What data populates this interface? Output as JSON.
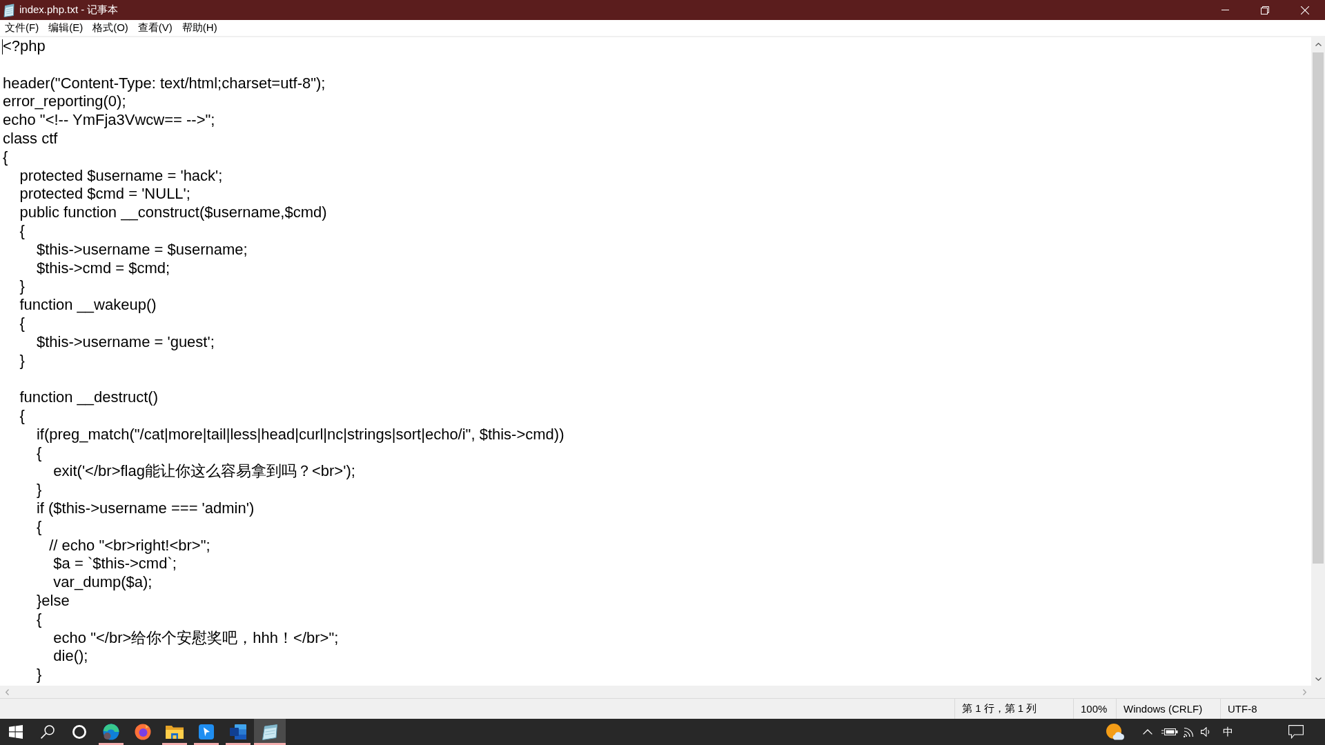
{
  "window": {
    "title": "index.php.txt - 记事本"
  },
  "menu": [
    "文件(F)",
    "编辑(E)",
    "格式(O)",
    "查看(V)",
    "帮助(H)"
  ],
  "editor": {
    "blocks": [
      [
        "<?php"
      ],
      [
        "header(\"Content-Type: text/html;charset=utf-8\");",
        "error_reporting(0);",
        "echo \"<!-- YmFja3Vwcw== -->\";",
        "class ctf",
        "{",
        "    protected $username = 'hack';",
        "    protected $cmd = 'NULL';",
        "    public function __construct($username,$cmd)",
        "    {",
        "        $this->username = $username;",
        "        $this->cmd = $cmd;",
        "    }",
        "    function __wakeup()",
        "    {",
        "        $this->username = 'guest';",
        "    }"
      ],
      [
        "    function __destruct()",
        "    {",
        "        if(preg_match(\"/cat|more|tail|less|head|curl|nc|strings|sort|echo/i\", $this->cmd))",
        "        {",
        "            exit('</br>flag能让你这么容易拿到吗？<br>');",
        "        }",
        "        if ($this->username === 'admin')",
        "        {",
        "           // echo \"<br>right!<br>\";",
        "            $a = `$this->cmd`;",
        "            var_dump($a);",
        "        }else",
        "        {",
        "            echo \"</br>给你个安慰奖吧，hhh！</br>\";",
        "            die();",
        "        }"
      ]
    ]
  },
  "status_bar": {
    "position": "第 1 行，第 1 列",
    "zoom": "100%",
    "line_ending": "Windows (CRLF)",
    "encoding": "UTF-8"
  },
  "taskbar": {
    "apps": [
      {
        "running": true,
        "selected": false
      },
      {
        "running": false,
        "selected": false
      },
      {
        "running": true,
        "selected": false
      },
      {
        "running": true,
        "selected": false
      },
      {
        "running": true,
        "selected": false
      },
      {
        "running": true,
        "selected": true
      }
    ],
    "ime": "中"
  }
}
